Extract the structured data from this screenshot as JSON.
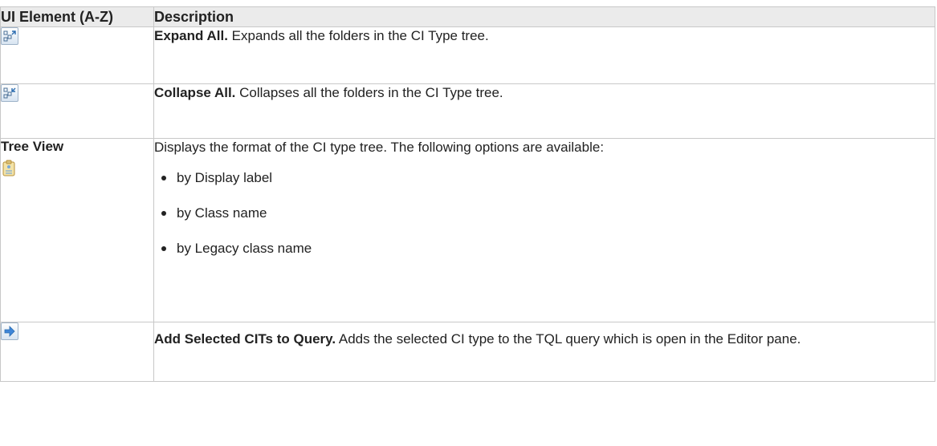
{
  "table": {
    "header": {
      "col1": "UI Element (A-Z)",
      "col2": "Description"
    },
    "rows": [
      {
        "icon": "expand-all-icon",
        "term": "Expand All.",
        "text": " Expands all the folders in the CI Type tree."
      },
      {
        "icon": "collapse-all-icon",
        "term": "Collapse All.",
        "text": " Collapses all the folders in the CI Type tree."
      },
      {
        "element_label": "Tree View",
        "icon": "tree-view-icon",
        "text": "Displays the format of the CI type tree. The following options are available:",
        "options": [
          "by Display label",
          "by Class name",
          "by Legacy class name"
        ]
      },
      {
        "icon": "add-arrow-icon",
        "term": "Add Selected CITs to Query.",
        "text": " Adds the selected CI type to the TQL query which is open in the Editor pane."
      }
    ]
  },
  "colors": {
    "header_bg": "#ebebeb",
    "border": "#c8c8c8",
    "icon_blue": "#2b6cb0"
  }
}
